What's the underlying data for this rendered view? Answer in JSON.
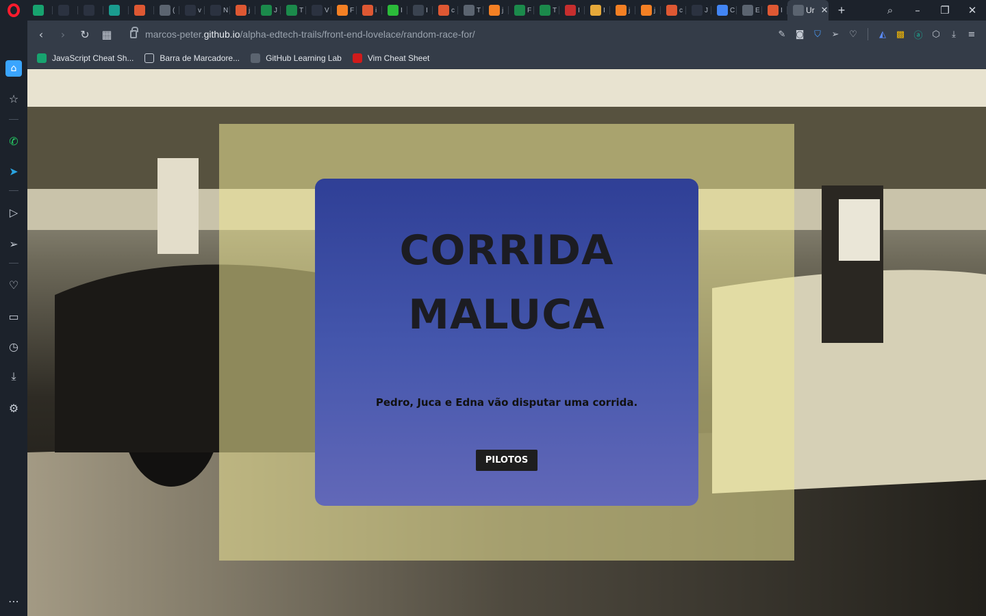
{
  "browser": {
    "tabs": [
      {
        "icon": "stack-icon",
        "color": "#17a36f",
        "label": ""
      },
      {
        "icon": "dev-icon",
        "color": "#2b3240",
        "label": ""
      },
      {
        "icon": "github-icon",
        "color": "#2b3240",
        "label": ""
      },
      {
        "icon": "doc-icon",
        "color": "#1a9c8f",
        "label": ""
      },
      {
        "icon": "duck-icon",
        "color": "#de5833",
        "label": ""
      },
      {
        "icon": "gear-icon",
        "color": "#5b6470",
        "label": "("
      },
      {
        "icon": "hat-icon",
        "color": "#2b3240",
        "label": "v"
      },
      {
        "icon": "hat-icon",
        "color": "#2b3240",
        "label": "N"
      },
      {
        "icon": "duck-icon",
        "color": "#de5833",
        "label": "j"
      },
      {
        "icon": "w-icon",
        "color": "#1b8a4b",
        "label": "J"
      },
      {
        "icon": "w-icon",
        "color": "#1b8a4b",
        "label": "T"
      },
      {
        "icon": "hat-icon",
        "color": "#2b3240",
        "label": "V"
      },
      {
        "icon": "so-icon",
        "color": "#f48024",
        "label": "F"
      },
      {
        "icon": "duck-icon",
        "color": "#de5833",
        "label": "i"
      },
      {
        "icon": "shield-icon",
        "color": "#2bbb3a",
        "label": "I"
      },
      {
        "icon": "code-icon",
        "color": "#3a4350",
        "label": "I"
      },
      {
        "icon": "duck-icon",
        "color": "#de5833",
        "label": "c"
      },
      {
        "icon": "globe-icon",
        "color": "#5b6470",
        "label": "T"
      },
      {
        "icon": "so-icon",
        "color": "#f48024",
        "label": "j"
      },
      {
        "icon": "w-icon",
        "color": "#1b8a4b",
        "label": "F"
      },
      {
        "icon": "w-icon",
        "color": "#1b8a4b",
        "label": "T"
      },
      {
        "icon": "chrome-icon",
        "color": "#c62e2e",
        "label": "I"
      },
      {
        "icon": "smile-icon",
        "color": "#e6a93a",
        "label": "I"
      },
      {
        "icon": "so-icon",
        "color": "#f48024",
        "label": "j"
      },
      {
        "icon": "so-icon",
        "color": "#f48024",
        "label": "j"
      },
      {
        "icon": "duck-icon",
        "color": "#de5833",
        "label": "c"
      },
      {
        "icon": "dev-icon",
        "color": "#2b3240",
        "label": "J"
      },
      {
        "icon": "translate-icon",
        "color": "#4285f4",
        "label": "C"
      },
      {
        "icon": "gear-icon",
        "color": "#5b6470",
        "label": "E"
      },
      {
        "icon": "duck-icon",
        "color": "#de5833",
        "label": "I"
      }
    ],
    "active_tab_label": "Ur",
    "address": {
      "prefix": "marcos-peter.",
      "domain": "github.io",
      "path": "/alpha-edtech-trails/front-end-lovelace/random-race-for/"
    },
    "bookmarks": [
      {
        "icon": "stack-icon",
        "color": "#17a36f",
        "label": "JavaScript Cheat Sh..."
      },
      {
        "icon": "folder-icon",
        "color": "#343c48",
        "label": "Barra de Marcadore..."
      },
      {
        "icon": "github-lab-icon",
        "color": "#5b6470",
        "label": "GitHub Learning Lab"
      },
      {
        "icon": "vim-icon",
        "color": "#d01b1b",
        "label": "Vim Cheat Sheet"
      }
    ]
  },
  "page": {
    "title_line1": "CORRIDA",
    "title_line2": "MALUCA",
    "subtitle": "Pedro, Juca e Edna vão disputar uma corrida.",
    "button_label": "PILOTOS"
  }
}
